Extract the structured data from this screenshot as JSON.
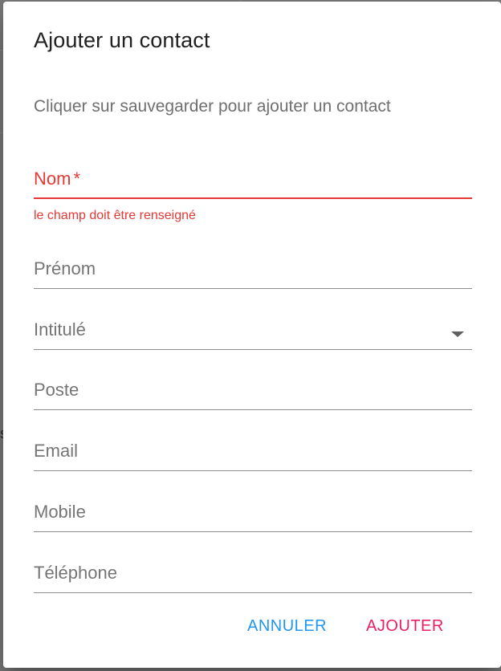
{
  "dialog": {
    "title": "Ajouter un contact",
    "subtitle": "Cliquer sur sauvegarder pour ajouter un contact"
  },
  "form": {
    "nom": {
      "label": "Nom",
      "required_mark": "*",
      "error": "le champ doit être renseigné"
    },
    "prenom": {
      "label": "Prénom"
    },
    "intitule": {
      "label": "Intitulé"
    },
    "poste": {
      "label": "Poste"
    },
    "email": {
      "label": "Email"
    },
    "mobile": {
      "label": "Mobile"
    },
    "telephone": {
      "label": "Téléphone"
    }
  },
  "actions": {
    "cancel_label": "ANNULER",
    "submit_label": "AJOUTER"
  },
  "background": {
    "partial_glyph": "s"
  },
  "colors": {
    "error": "#e53935",
    "cancel": "#2196f3",
    "submit": "#e91e63"
  }
}
